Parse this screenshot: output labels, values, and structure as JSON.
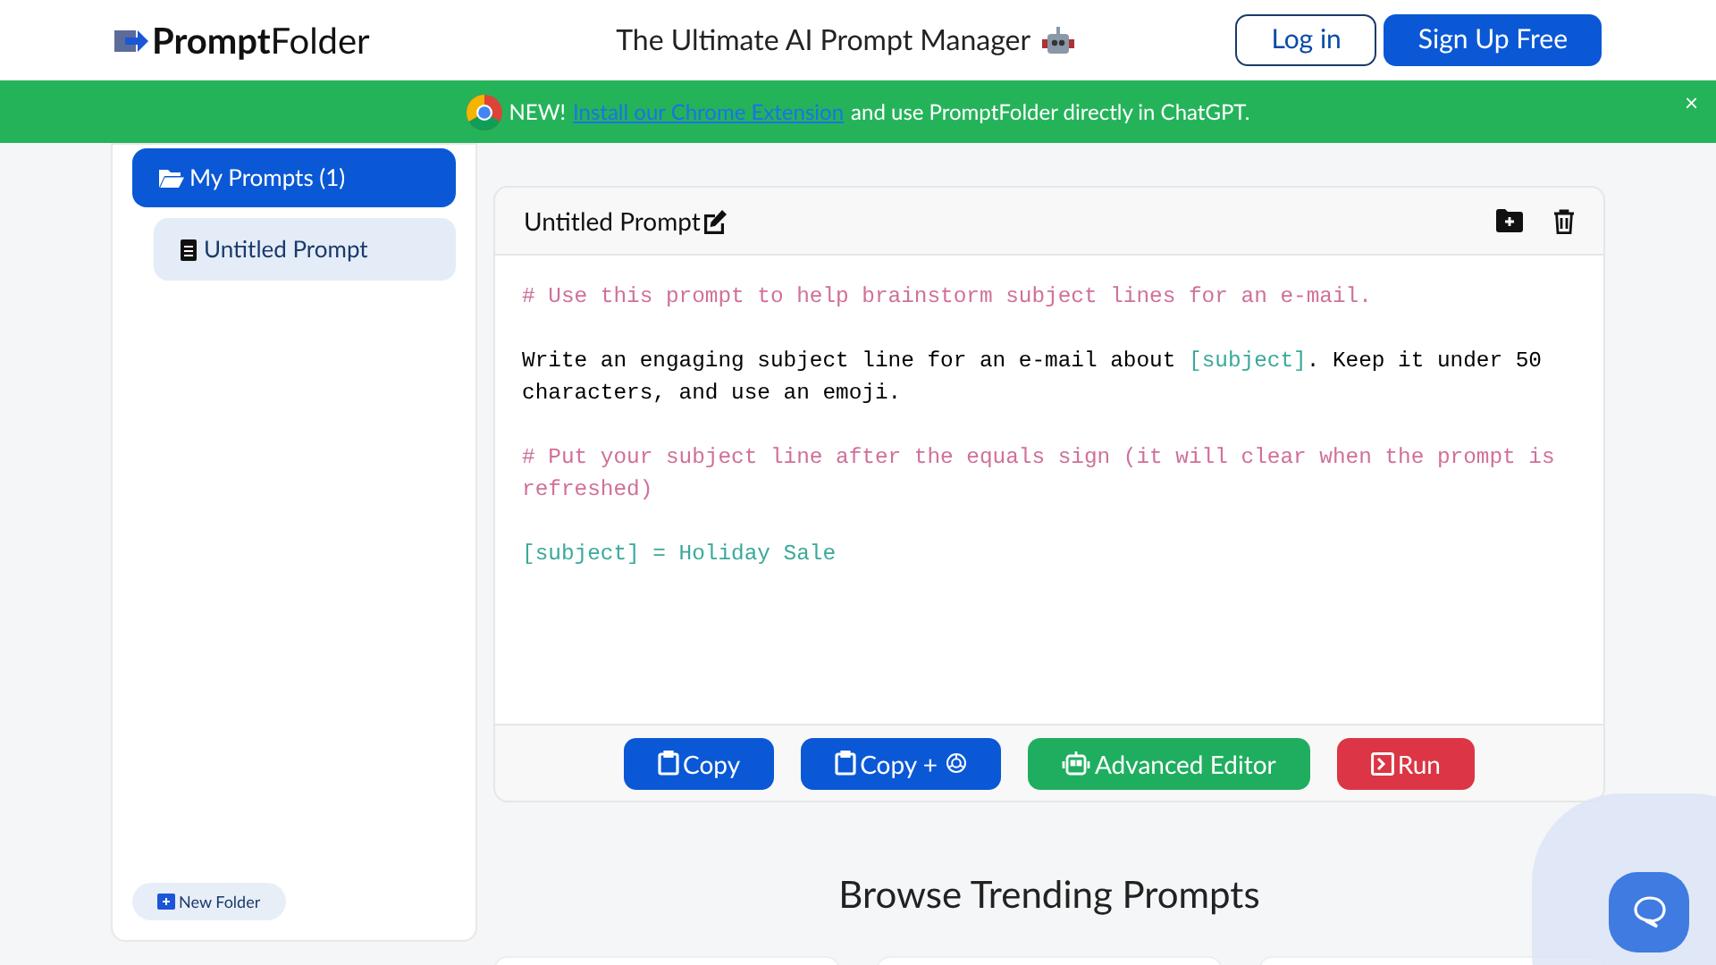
{
  "header": {
    "logo": {
      "bold": "Prompt",
      "rest": "Folder"
    },
    "tagline": "The Ultimate AI Prompt Manager",
    "buttons": [
      {
        "label": "Log in",
        "kind": "outline"
      },
      {
        "label": "Sign Up Free",
        "kind": "solid"
      }
    ]
  },
  "banner": {
    "badge": "NEW!",
    "link": "Install our Chrome Extension",
    "text": "and use PromptFolder directly in ChatGPT.",
    "close": "×"
  },
  "sidebar": {
    "items": [
      {
        "label": "My Prompts (1)",
        "selected": true,
        "children": [
          {
            "label": "Untitled Prompt",
            "selected": false
          }
        ]
      }
    ],
    "new_folder": "New Folder"
  },
  "editor": {
    "title": "Untitled Prompt",
    "lines": [
      [
        {
          "text": "# Use this prompt to help brainstorm subject lines for an e-mail.",
          "kind": "comment"
        }
      ],
      [
        {
          "text": "Write an engaging subject line for an e-mail about ",
          "kind": "plain"
        },
        {
          "text": "[subject]",
          "kind": "variable"
        },
        {
          "text": ". Keep it under 50 characters, and use an emoji.",
          "kind": "plain"
        }
      ],
      [
        {
          "text": "# Put your subject line after the equals sign (it will clear when the prompt is refreshed)",
          "kind": "comment"
        }
      ],
      [
        {
          "text": "[subject] = Holiday Sale",
          "kind": "variable"
        }
      ]
    ],
    "actions": [
      {
        "label": "Copy",
        "kind": "copy"
      },
      {
        "label": "Copy +",
        "kind": "copy-gpt"
      },
      {
        "label": "Advanced Editor",
        "kind": "editor"
      },
      {
        "label": "Run",
        "kind": "run"
      }
    ]
  },
  "trending": {
    "title": "Browse Trending Prompts"
  }
}
